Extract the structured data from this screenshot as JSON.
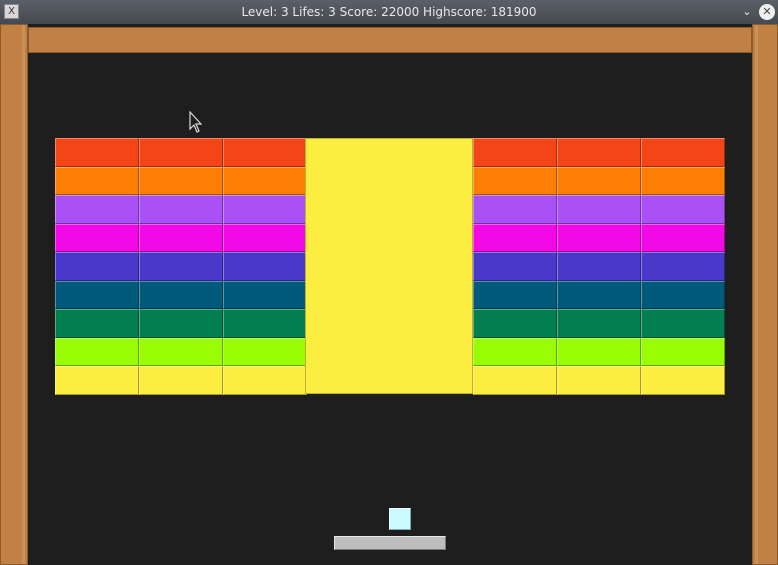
{
  "window": {
    "title": "Level: 3 Lifes: 3 Score: 22000 Highscore: 181900",
    "app_icon": "x-app-icon",
    "minimize_icon": "chevron-down-icon",
    "close_icon": "close-icon",
    "app_icon_glyph": "X",
    "minimize_glyph": "⌄",
    "close_glyph": "✕"
  },
  "colors": {
    "wall": "#c18144",
    "background": "#1e1e1e",
    "ball": "#c9fbff",
    "paddle": "#bdbdbd",
    "big_brick": "#fcee41"
  },
  "bricks": {
    "row_colors": [
      "#f44517",
      "#fe7d03",
      "#aa51f6",
      "#f20ae6",
      "#4939ca",
      "#015a7b",
      "#037e50",
      "#98fd03",
      "#fcee41"
    ],
    "left_columns": 3,
    "right_columns": 3
  }
}
